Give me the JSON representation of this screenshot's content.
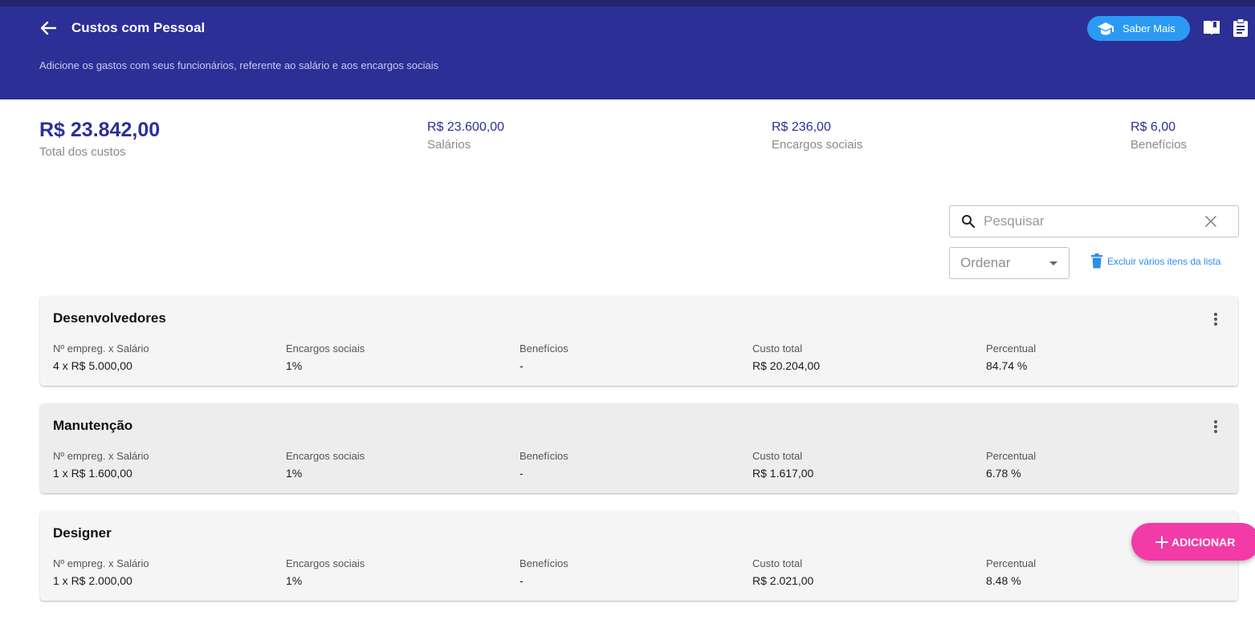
{
  "header": {
    "title": "Custos com Pessoal",
    "subtitle": "Adicione os gastos com seus funcionários, referente ao salário e aos encargos sociais",
    "saber_mais_label": "Saber Mais",
    "bg_color": "#2c2f95"
  },
  "summary": {
    "total": {
      "value": "R$ 23.842,00",
      "label": "Total dos custos"
    },
    "salarios": {
      "value": "R$ 23.600,00",
      "label": "Salários"
    },
    "encargos": {
      "value": "R$ 236,00",
      "label": "Encargos sociais"
    },
    "beneficios": {
      "value": "R$ 6,00",
      "label": "Benefícios"
    }
  },
  "toolbar": {
    "search_placeholder": "Pesquisar",
    "order_label": "Ordenar",
    "bulk_delete_label": "Excluir vários itens da lista"
  },
  "columns": {
    "emp_salario": "Nº empreg. x Salário",
    "encargos": "Encargos sociais",
    "beneficios": "Benefícios",
    "custo_total": "Custo total",
    "percentual": "Percentual"
  },
  "groups": [
    {
      "name": "Desenvolvedores",
      "emp_salario": "4 x R$ 5.000,00",
      "encargos": "1%",
      "beneficios": "-",
      "custo_total": "R$ 20.204,00",
      "percentual": "84.74 %"
    },
    {
      "name": "Manutenção",
      "emp_salario": "1 x R$ 1.600,00",
      "encargos": "1%",
      "beneficios": "-",
      "custo_total": "R$ 1.617,00",
      "percentual": "6.78 %"
    },
    {
      "name": "Designer",
      "emp_salario": "1 x R$ 2.000,00",
      "encargos": "1%",
      "beneficios": "-",
      "custo_total": "R$ 2.021,00",
      "percentual": "8.48 %"
    }
  ],
  "fab": {
    "label": "ADICIONAR",
    "color": "#f23ba6"
  },
  "icons": {
    "back": "arrow-left-icon",
    "saber_mais": "graduation-cap-icon",
    "book": "book-open-icon",
    "clipboard": "clipboard-icon",
    "search": "search-icon",
    "clear": "close-icon",
    "order": "caret-down-icon",
    "trash": "trash-icon",
    "menu": "more-vert-icon",
    "add": "plus-icon"
  }
}
